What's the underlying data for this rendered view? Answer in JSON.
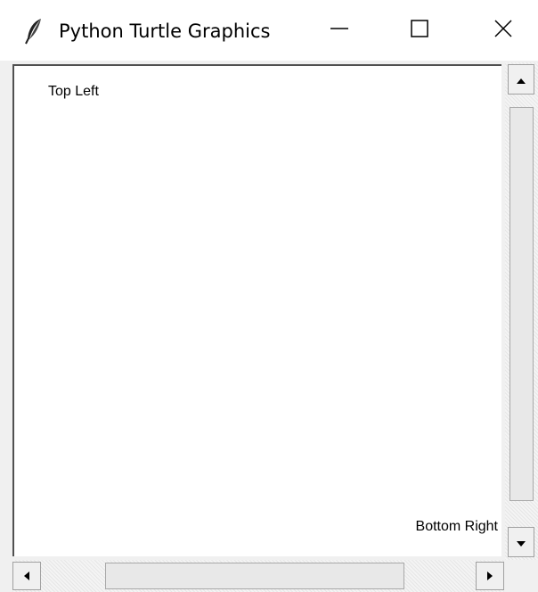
{
  "window": {
    "title": "Python Turtle Graphics",
    "icon": "feather-icon",
    "controls": {
      "minimize": "minimize-icon",
      "maximize": "maximize-icon",
      "close": "close-icon"
    }
  },
  "canvas": {
    "top_left_label": "Top Left",
    "bottom_right_label": "Bottom Right"
  },
  "scrollbars": {
    "vertical": {
      "up_icon": "arrow-up-icon",
      "down_icon": "arrow-down-icon"
    },
    "horizontal": {
      "left_icon": "arrow-left-icon",
      "right_icon": "arrow-right-icon"
    }
  }
}
